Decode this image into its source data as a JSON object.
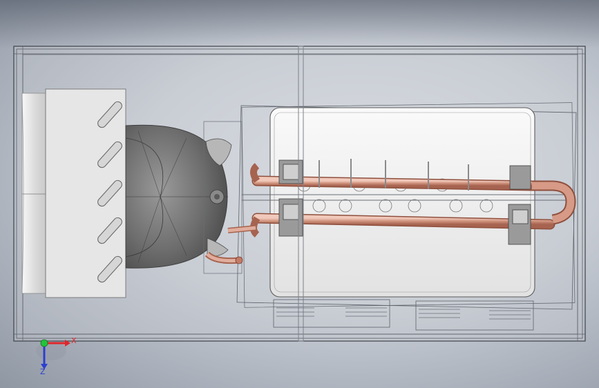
{
  "triad": {
    "x_label": "X",
    "z_label": "Z",
    "x_color": "#e0262b",
    "z_color": "#2b3fd0",
    "origin_color": "#22c43a"
  },
  "colors": {
    "copper": "#c98a78",
    "copper_light": "#e5b7a8",
    "housing_edge": "#4a4e55",
    "condenser_fill": "#f0f0f0",
    "fan_fill": "#e7e7e7"
  },
  "icons": [
    "view-triad-icon"
  ]
}
